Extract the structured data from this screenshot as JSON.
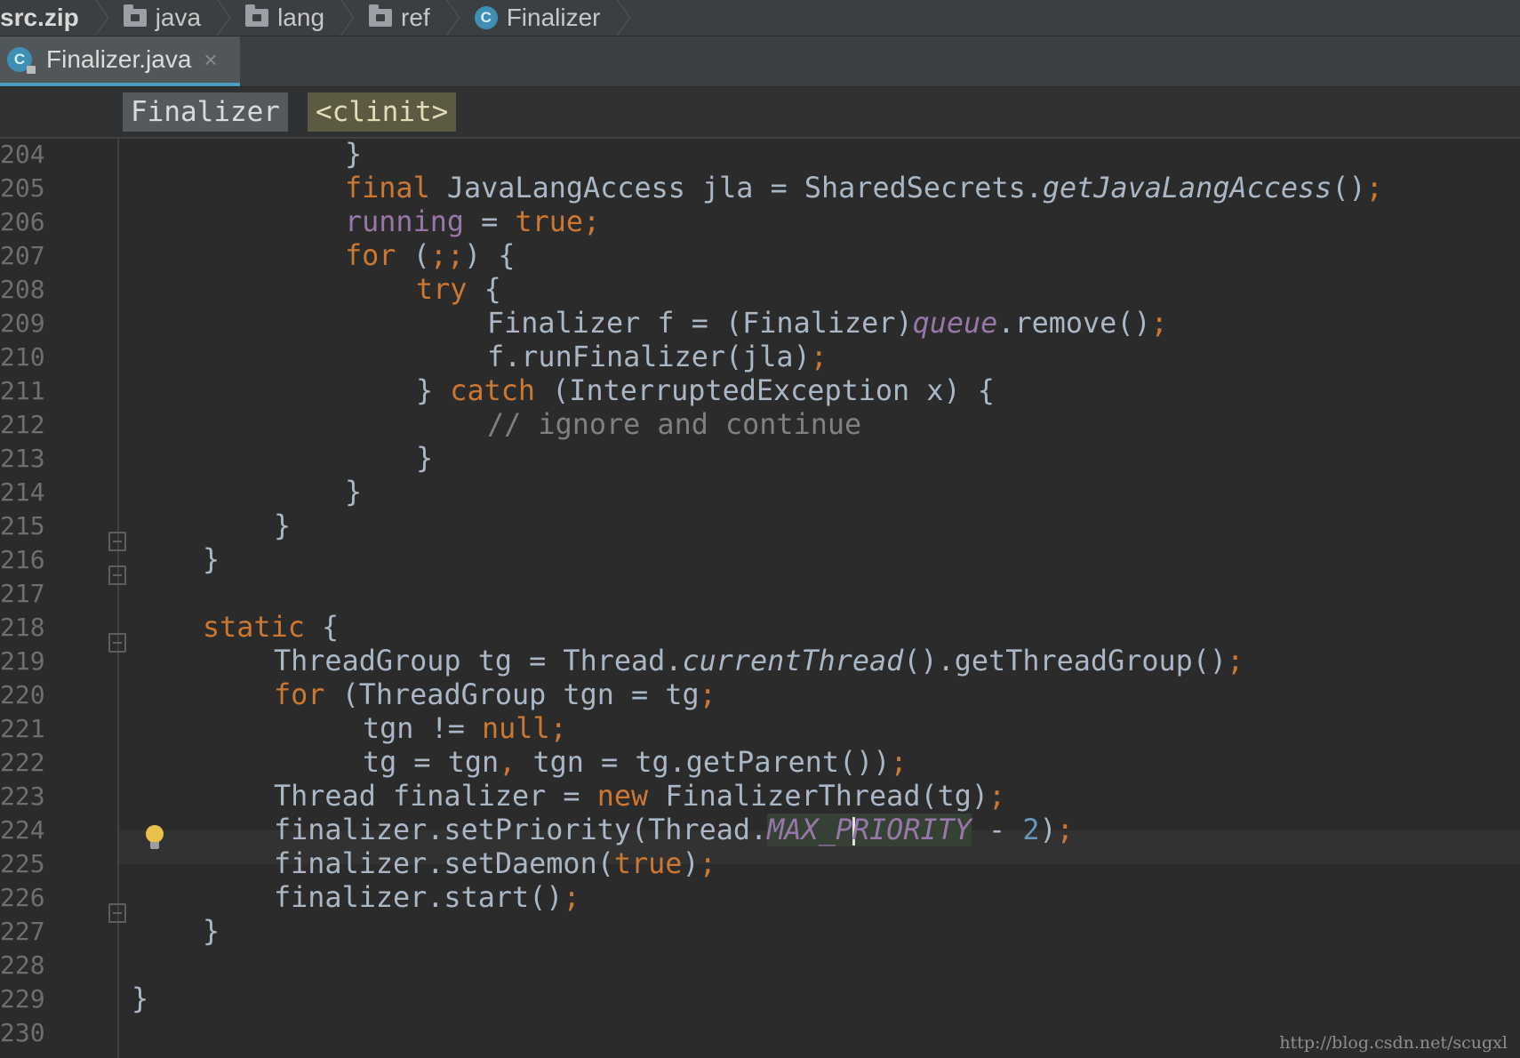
{
  "breadcrumb": [
    {
      "label": "src.zip",
      "icon": ""
    },
    {
      "label": "java",
      "icon": "folder-icon"
    },
    {
      "label": "lang",
      "icon": "folder-icon"
    },
    {
      "label": "ref",
      "icon": "folder-icon"
    },
    {
      "label": "Finalizer",
      "icon": "class-icon"
    }
  ],
  "tab": {
    "label": "Finalizer.java",
    "close": "×",
    "icon_letter": "C"
  },
  "structure": {
    "class": "Finalizer",
    "method": "<clinit>"
  },
  "editor": {
    "lines": [
      "204",
      "205",
      "206",
      "207",
      "208",
      "209",
      "210",
      "211",
      "212",
      "213",
      "214",
      "215",
      "216",
      "217",
      "218",
      "219",
      "220",
      "221",
      "222",
      "223",
      "224",
      "225",
      "226",
      "227",
      "228",
      "229",
      "230"
    ],
    "code": {
      "l204_brace": "}",
      "l205_kw": "final",
      "l205_rest": " JavaLangAccess jla = SharedSecrets.",
      "l205_method": "getJavaLangAccess",
      "l205_tail": "()",
      "l206_field": "running",
      "l206_mid": " = ",
      "l206_kw": "true",
      "l207_kw": "for",
      "l207_rest": " (",
      "l207_semis": ";;",
      "l207_tail": ") {",
      "l208_kw": "try",
      "l208_tail": " {",
      "l209_rest": "Finalizer f = (Finalizer)",
      "l209_field": "queue",
      "l209_tail": ".remove()",
      "l210_rest": "f.runFinalizer(jla)",
      "l211_open": "} ",
      "l211_kw": "catch",
      "l211_tail": " (InterruptedException x) {",
      "l212_comment": "// ignore and continue",
      "l213_brace": "}",
      "l214_brace": "}",
      "l215_brace": "}",
      "l216_brace": "}",
      "l218_kw": "static",
      "l218_tail": " {",
      "l219_rest": "ThreadGroup tg = Thread.",
      "l219_method": "currentThread",
      "l219_tail": "().getThreadGroup()",
      "l220_kw": "for",
      "l220_rest": " (ThreadGroup tgn = tg",
      "l221_rest": "tgn != ",
      "l221_kw": "null",
      "l222_rest": "tg = tgn",
      "l222_comma": ",",
      "l222_tail": " tgn = tg.getParent())",
      "l223_rest": "Thread finalizer = ",
      "l223_kw": "new",
      "l223_tail": " FinalizerThread(tg)",
      "l224_rest": "finalizer.setPriority(Thread.",
      "l224_field_a": "MAX_P",
      "l224_field_b": "RIORITY",
      "l224_minus": " - ",
      "l224_num": "2",
      "l224_tail": ")",
      "l225_rest": "finalizer.setDaemon(",
      "l225_kw": "true",
      "l225_tail": ")",
      "l226_rest": "finalizer.start()",
      "l227_brace": "}",
      "l229_brace": "}",
      "semicolon": ";"
    }
  },
  "watermark": "http://blog.csdn.net/scugxl",
  "colors": {
    "keyword": "#cc7832",
    "field": "#9876aa",
    "number": "#6897bb",
    "comment": "#808080",
    "text": "#a9b7c6",
    "background": "#2b2b2b",
    "tab_underline": "#4a9cc0"
  }
}
